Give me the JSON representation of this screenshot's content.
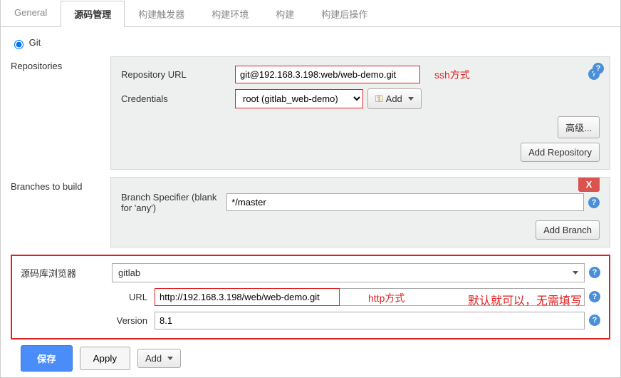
{
  "tabs": {
    "general": "General",
    "scm": "源码管理",
    "triggers": "构建触发器",
    "env": "构建环境",
    "build": "构建",
    "post": "构建后操作"
  },
  "scm_radio": "Git",
  "repositories": {
    "section_label": "Repositories",
    "repo_url_label": "Repository URL",
    "repo_url_value": "git@192.168.3.198:web/web-demo.git",
    "ssh_anno": "ssh方式",
    "credentials_label": "Credentials",
    "credentials_selected": "root (gitlab_web-demo)",
    "add_btn": "Add",
    "advanced_btn": "高级...",
    "add_repo_btn": "Add Repository"
  },
  "branches": {
    "section_label": "Branches to build",
    "branch_specifier_label": "Branch Specifier (blank for 'any')",
    "branch_value": "*/master",
    "delete_x": "X",
    "add_branch_btn": "Add Branch"
  },
  "browser": {
    "label": "源码库浏览器",
    "selected": "gitlab",
    "url_label": "URL",
    "url_value": "http://192.168.3.198/web/web-demo.git",
    "http_anno": "http方式",
    "version_label": "Version",
    "version_value": "8.1",
    "note_anno": "默认就可以，无需填写"
  },
  "bottom": {
    "save": "保存",
    "apply": "Apply",
    "add_menu": "Add"
  },
  "help_char": "?"
}
